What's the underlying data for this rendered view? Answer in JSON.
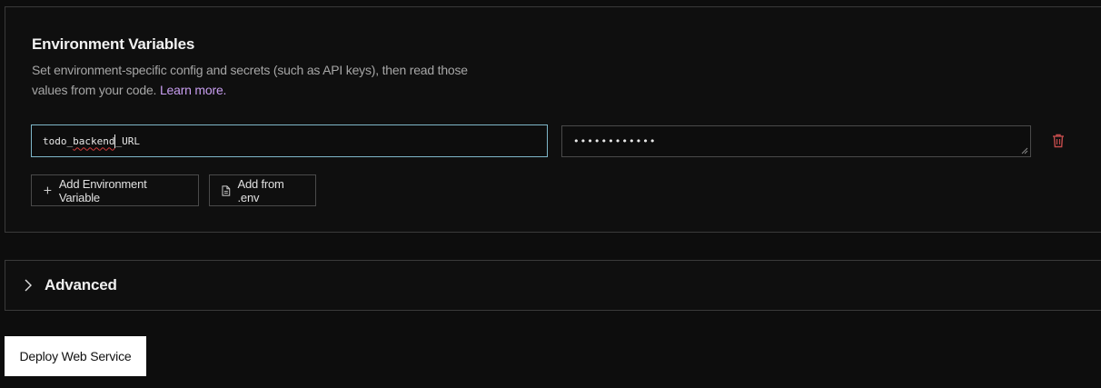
{
  "env_section": {
    "title": "Environment Variables",
    "description": "Set environment-specific config and secrets (such as API keys), then read those values from your code.",
    "learn_more": "Learn more.",
    "key_value_before_caret": "todo_backend",
    "key_value_after_caret": "_URL",
    "key_misspelled_word": "backend",
    "value_masked": "••••••••••••",
    "add_variable_label": "Add Environment Variable",
    "add_from_file_label": "Add from .env",
    "icons": {
      "add": "plus-icon",
      "file": "file-icon",
      "delete": "trash-icon"
    },
    "colors": {
      "focused_border": "#7fb7c9",
      "link": "#c89ef0",
      "delete_icon": "#c24b4b"
    }
  },
  "advanced": {
    "label": "Advanced",
    "icon": "chevron-right-icon"
  },
  "deploy": {
    "label": "Deploy Web Service"
  }
}
